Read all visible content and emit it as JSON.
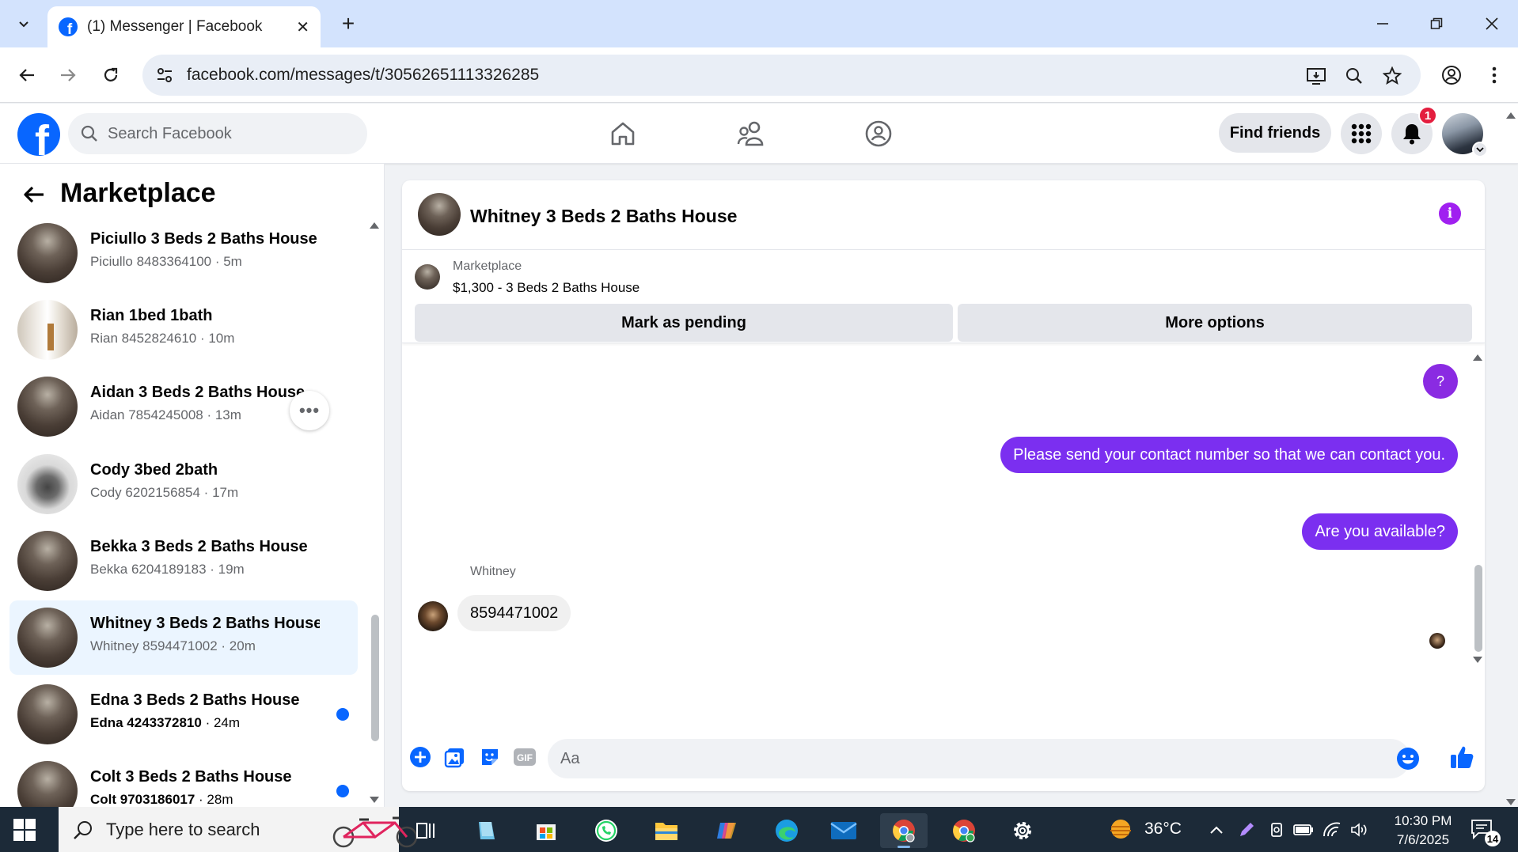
{
  "browser": {
    "tab_title": "(1) Messenger | Facebook",
    "url": "facebook.com/messages/t/30562651113326285"
  },
  "fb_header": {
    "search_placeholder": "Search Facebook",
    "find_friends_label": "Find friends",
    "notification_count": "1"
  },
  "sidebar": {
    "title": "Marketplace",
    "conversations": [
      {
        "name": "Piciullo 3 Beds 2 Baths House",
        "subtitle": "Piciullo 8483364100 · 5m",
        "unread": false,
        "active": false
      },
      {
        "name": "Rian 1bed 1bath",
        "subtitle": "Rian 8452824610 · 10m",
        "unread": false,
        "active": false
      },
      {
        "name": "Aidan 3 Beds 2 Baths House",
        "subtitle": "Aidan 7854245008 · 13m",
        "unread": false,
        "active": false
      },
      {
        "name": "Cody 3bed 2bath",
        "subtitle": "Cody 6202156854 · 17m",
        "unread": false,
        "active": false
      },
      {
        "name": "Bekka 3 Beds 2 Baths House",
        "subtitle": "Bekka 6204189183 · 19m",
        "unread": false,
        "active": false
      },
      {
        "name": "Whitney 3 Beds 2 Baths House",
        "subtitle": "Whitney 8594471002 · 20m",
        "unread": false,
        "active": true
      },
      {
        "name": "Edna 3 Beds 2 Baths House",
        "subtitle_bold": "Edna 4243372810",
        "subtitle_rest": " · 24m",
        "unread": true,
        "active": false
      },
      {
        "name": "Colt 3 Beds 2 Baths House",
        "subtitle_bold": "Colt 9703186017",
        "subtitle_rest": " · 28m",
        "unread": true,
        "active": false
      }
    ]
  },
  "chat": {
    "title": "Whitney 3 Beds 2 Baths House",
    "listing_label": "Marketplace",
    "listing_desc": "$1,300 - 3 Beds 2 Baths House",
    "mark_pending_label": "Mark as pending",
    "more_options_label": "More options",
    "help_label": "?",
    "messages": [
      {
        "direction": "out",
        "text": "Please send your contact number so that we can contact you."
      },
      {
        "direction": "out",
        "text": "Are you available?"
      },
      {
        "direction": "in",
        "sender": "Whitney",
        "text": "8594471002"
      }
    ],
    "input_placeholder": "Aa"
  },
  "taskbar": {
    "search_placeholder": "Type here to search",
    "weather": "36°C",
    "time": "10:30 PM",
    "date": "7/6/2025",
    "notification_count": "14"
  }
}
